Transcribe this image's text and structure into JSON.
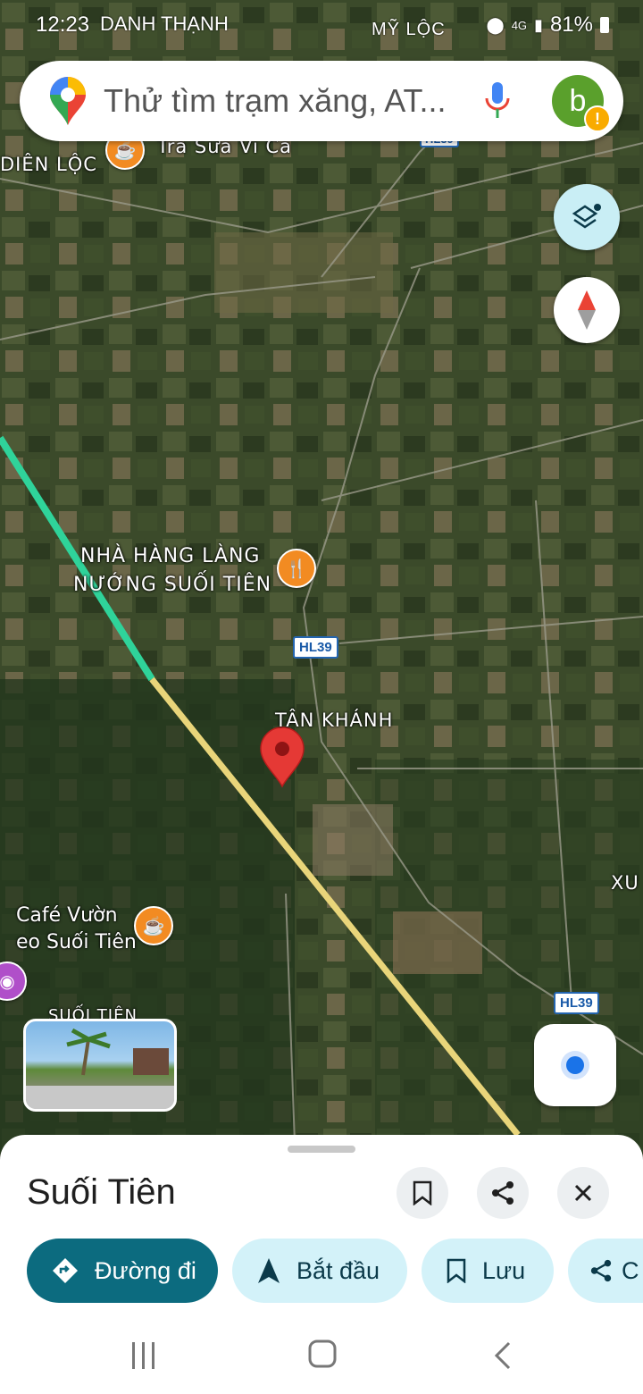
{
  "status_bar": {
    "time": "12:23",
    "carrier": "DANH THẠNH",
    "location_label": "MỸ LỘC",
    "network": "4G",
    "battery": "81%"
  },
  "search": {
    "placeholder": "Thử tìm trạm xăng, AT...",
    "avatar_letter": "b"
  },
  "map": {
    "labels": {
      "tra_sua": "Trà Sữa Vi Ca",
      "dien_loc": "DIÊN LỘC",
      "nha_hang_line1": "NHÀ HÀNG LÀNG",
      "nha_hang_line2": "NƯỚNG SUỐI TIÊN",
      "tan_khanh": "TÂN KHÁNH",
      "cafe_line1": "Café Vườn",
      "cafe_line2": "eo Suối Tiên",
      "suoi_tien": "SUỐI TIÊN",
      "xu": "XU"
    },
    "road_shields": [
      "HL39",
      "HL39",
      "HL39"
    ],
    "colors": {
      "highway": "#e9d57a",
      "highway_green": "#2fd39a",
      "pin": "#e53935",
      "poi": "#f28b22",
      "accent": "#0c6b7f"
    }
  },
  "place": {
    "title": "Suối Tiên"
  },
  "actions": {
    "directions": "Đường đi",
    "start": "Bắt đầu",
    "save": "Lưu",
    "share_partial": "C"
  },
  "icons": {
    "save_icon": "bookmark-icon",
    "share_icon": "share-icon",
    "close_icon": "close-icon",
    "layers_icon": "layers-icon",
    "compass_icon": "compass-icon",
    "location_icon": "my-location-icon"
  }
}
